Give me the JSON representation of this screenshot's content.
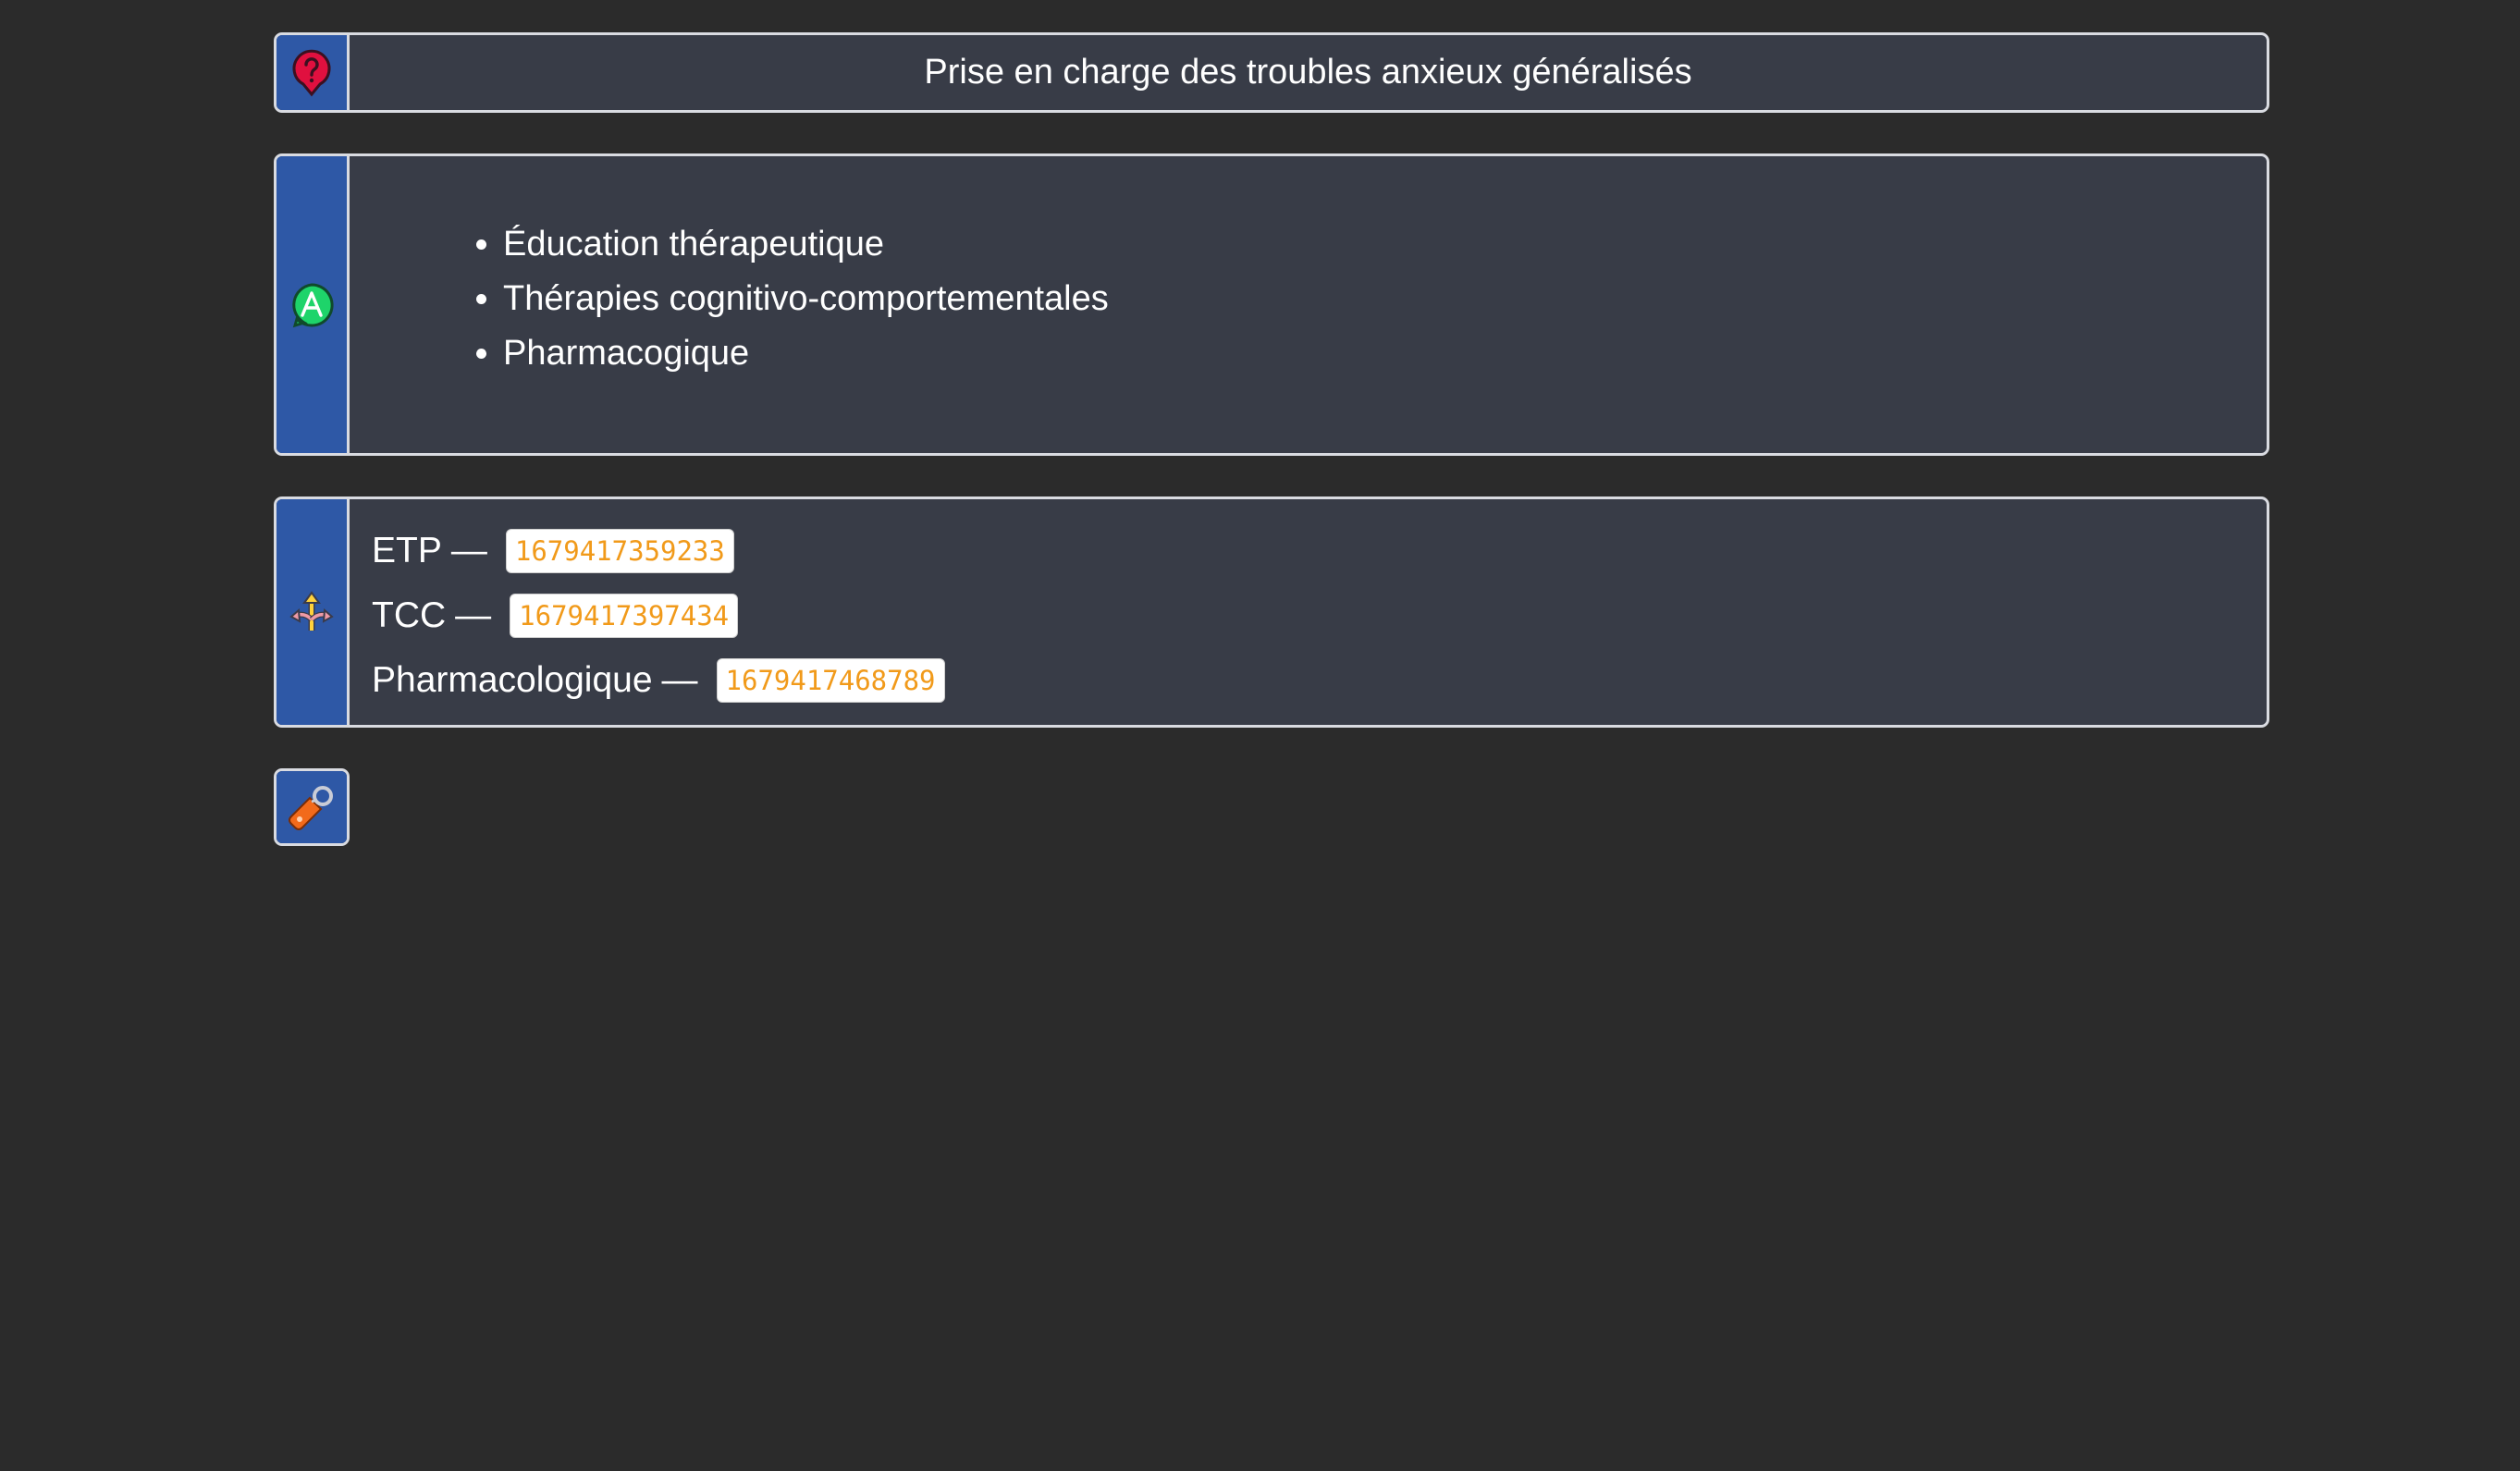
{
  "question": {
    "icon": "question-pin-icon",
    "title": "Prise en charge des troubles anxieux généralisés"
  },
  "answer": {
    "icon": "answer-a-icon",
    "items": [
      "Éducation thérapeutique",
      "Thérapies cognitivo-comportementales",
      "Pharmacogique"
    ]
  },
  "links": {
    "icon": "branch-arrows-icon",
    "separator": "—",
    "rows": [
      {
        "label": "ETP",
        "id": "1679417359233"
      },
      {
        "label": "TCC",
        "id": "1679417397434"
      },
      {
        "label": "Pharmacologique",
        "id": "1679417468789"
      }
    ]
  },
  "tags": {
    "icon": "tag-icon"
  },
  "colors": {
    "background": "#2b2b2b",
    "card": "#383c47",
    "sidebar": "#2e58a6",
    "border": "#d9dbe1",
    "id_text": "#f19a1a"
  }
}
